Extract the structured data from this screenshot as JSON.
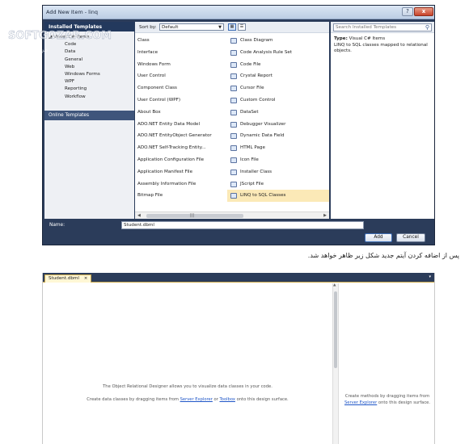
{
  "dialog": {
    "title": "Add New Item - linq",
    "title_buttons": [
      "?",
      "x"
    ],
    "left_pane": {
      "installed_header": "Installed Templates",
      "tree": [
        {
          "label": "◢ Visual C# Items",
          "level": 0
        },
        {
          "label": "Code",
          "level": 1
        },
        {
          "label": "Data",
          "level": 1
        },
        {
          "label": "General",
          "level": 1
        },
        {
          "label": "Web",
          "level": 1
        },
        {
          "label": "Windows Forms",
          "level": 1
        },
        {
          "label": "WPF",
          "level": 1
        },
        {
          "label": "Reporting",
          "level": 1
        },
        {
          "label": "Workflow",
          "level": 1
        }
      ],
      "online_header": "Online Templates"
    },
    "toolbar": {
      "sort_label": "Sort by:",
      "sort_value": "Default"
    },
    "templates_left": [
      "Class",
      "Interface",
      "Windows Form",
      "User Control",
      "Component Class",
      "User Control (WPF)",
      "About Box",
      "ADO.NET Entity Data Model",
      "ADO.NET EntityObject Generator",
      "ADO.NET Self-Tracking Entity...",
      "Application Configuration File",
      "Application Manifest File",
      "Assembly Information File",
      "Bitmap File"
    ],
    "templates_right": [
      {
        "label": "Class Diagram",
        "icon": "class-diagram-icon"
      },
      {
        "label": "Code Analysis Rule Set",
        "icon": "rule-set-icon"
      },
      {
        "label": "Code File",
        "icon": "code-file-icon"
      },
      {
        "label": "Crystal Report",
        "icon": "crystal-report-icon"
      },
      {
        "label": "Cursor File",
        "icon": "cursor-file-icon"
      },
      {
        "label": "Custom Control",
        "icon": "custom-control-icon"
      },
      {
        "label": "DataSet",
        "icon": "dataset-icon"
      },
      {
        "label": "Debugger Visualizer",
        "icon": "debugger-visualizer-icon"
      },
      {
        "label": "Dynamic Data Field",
        "icon": "dynamic-data-icon"
      },
      {
        "label": "HTML Page",
        "icon": "html-page-icon"
      },
      {
        "label": "Icon File",
        "icon": "icon-file-icon"
      },
      {
        "label": "Installer Class",
        "icon": "installer-class-icon"
      },
      {
        "label": "JScript File",
        "icon": "jscript-file-icon"
      },
      {
        "label": "LINQ to SQL Classes",
        "icon": "linq-to-sql-icon",
        "selected": true
      }
    ],
    "right_pane": {
      "search_placeholder": "Search Installed Templates",
      "type_label": "Type:",
      "type_value": "Visual C# Items",
      "description": "LINQ to SQL classes mapped to relational objects."
    },
    "name_label": "Name:",
    "name_value": "Student.dbml",
    "add_label": "Add",
    "cancel_label": "Cancel"
  },
  "caption": "پس از اضافه کردن آیتم جدید شکل زیر ظاهر خواهد شد.",
  "designer": {
    "tab_label": "Student.dbml",
    "tab_close": "×",
    "hint_line1": "The Object Relational Designer allows you to visualize data classes in your code.",
    "hint_line2_pre": "Create data classes by dragging items from ",
    "server_explorer": "Server Explorer",
    "or": " or ",
    "toolbox": "Toolbox",
    "hint_line2_post": " onto this design surface.",
    "methods_pre": "Create methods by dragging items from ",
    "methods_link": "Server Explorer",
    "methods_post": " onto this design surface."
  },
  "colors": {
    "dialog_frame": "#2b3c5a",
    "selection": "#fbe9b7",
    "link": "#1f56c8"
  }
}
